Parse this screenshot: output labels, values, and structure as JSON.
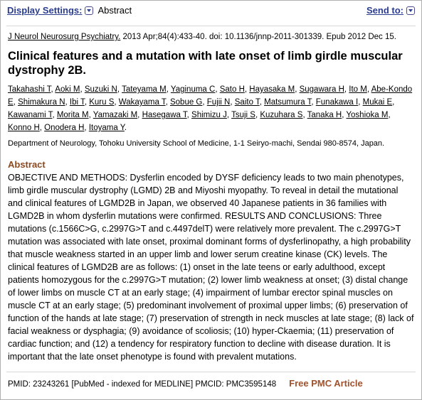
{
  "toolbar": {
    "display_settings_label": "Display Settings:",
    "display_mode": "Abstract",
    "send_to_label": "Send to:",
    "dropdown_icon": "chevron-down-icon"
  },
  "citation": {
    "journal": "J Neurol Neurosurg Psychiatry.",
    "details": " 2013 Apr;84(4):433-40. doi: 10.1136/jnnp-2011-301339. Epub 2012 Dec 15."
  },
  "article": {
    "title": "Clinical features and a mutation with late onset of limb girdle muscular dystrophy 2B.",
    "authors": [
      "Takahashi T",
      "Aoki M",
      "Suzuki N",
      "Tateyama M",
      "Yaginuma C",
      "Sato H",
      "Hayasaka M",
      "Sugawara H",
      "Ito M",
      "Abe-Kondo E",
      "Shimakura N",
      "Ibi T",
      "Kuru S",
      "Wakayama T",
      "Sobue G",
      "Fujii N",
      "Saito T",
      "Matsumura T",
      "Funakawa I",
      "Mukai E",
      "Kawanami T",
      "Morita M",
      "Yamazaki M",
      "Hasegawa T",
      "Shimizu J",
      "Tsuji S",
      "Kuzuhara S",
      "Tanaka H",
      "Yoshioka M",
      "Konno H",
      "Onodera H",
      "Itoyama Y"
    ],
    "affiliation": "Department of Neurology, Tohoku University School of Medicine, 1-1 Seiryo-machi, Sendai 980-8574, Japan.",
    "abstract_heading": "Abstract",
    "abstract_text": "OBJECTIVE AND METHODS: Dysferlin encoded by DYSF deficiency leads to two main phenotypes, limb girdle muscular dystrophy (LGMD) 2B and Miyoshi myopathy. To reveal in detail the mutational and clinical features of LGMD2B in Japan, we observed 40 Japanese patients in 36 families with LGMD2B in whom dysferlin mutations were confirmed. RESULTS AND CONCLUSIONS: Three mutations (c.1566C>G, c.2997G>T and c.4497delT) were relatively more prevalent. The c.2997G>T mutation was associated with late onset, proximal dominant forms of dysferlinopathy, a high probability that muscle weakness started in an upper limb and lower serum creatine kinase (CK) levels. The clinical features of LGMD2B are as follows: (1) onset in the late teens or early adulthood, except patients homozygous for the c.2997G>T mutation; (2) lower limb weakness at onset; (3) distal change of lower limbs on muscle CT at an early stage; (4) impairment of lumbar erector spinal muscles on muscle CT at an early stage; (5) predominant involvement of proximal upper limbs; (6) preservation of function of the hands at late stage; (7) preservation of strength in neck muscles at late stage; (8) lack of facial weakness or dysphagia; (9) avoidance of scoliosis; (10) hyper-Ckaemia; (11) preservation of cardiac function; and (12) a tendency for respiratory function to decline with disease duration. It is important that the late onset phenotype is found with prevalent mutations."
  },
  "footer": {
    "pmid_line": "PMID: 23243261 [PubMed - indexed for MEDLINE] PMCID: PMC3595148",
    "free_pmc_label": "Free PMC Article"
  },
  "colors": {
    "link_blue": "#2b3d8f",
    "abstract_heading_brown": "#8c4a21",
    "free_pmc_brown": "#a0522d"
  }
}
